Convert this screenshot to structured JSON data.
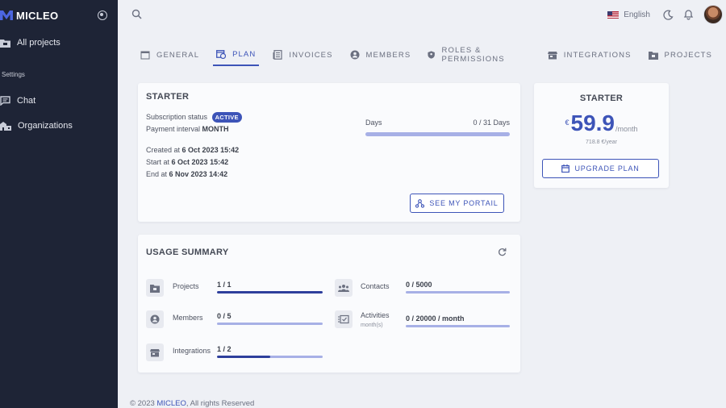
{
  "sidebar": {
    "brand": "MICLEO",
    "all_projects": "All projects",
    "section": "Settings",
    "items": [
      {
        "label": "Chat",
        "icon": "chat-icon"
      },
      {
        "label": "Organizations",
        "icon": "buildings-icon"
      }
    ]
  },
  "topbar": {
    "language": "English",
    "icons": [
      "search-icon",
      "dark-mode-icon",
      "bell-icon"
    ]
  },
  "tabs": [
    {
      "label": "GENERAL",
      "icon": "browser-icon"
    },
    {
      "label": "PLAN",
      "icon": "calendar-clock-icon",
      "active": true
    },
    {
      "label": "INVOICES",
      "icon": "invoice-icon"
    },
    {
      "label": "MEMBERS",
      "icon": "member-icon"
    },
    {
      "label": "ROLES & PERMISSIONS",
      "icon": "shield-icon"
    },
    {
      "label": "INTEGRATIONS",
      "icon": "store-icon"
    },
    {
      "label": "PROJECTS",
      "icon": "folder-icon"
    }
  ],
  "plan": {
    "title": "STARTER",
    "subscription_label": "Subscription status",
    "subscription_status": "ACTIVE",
    "interval_label": "Payment interval",
    "interval_value": "MONTH",
    "days_label": "Days",
    "days_value": "0 / 31 Days",
    "days_progress": 0,
    "created_label": "Created at",
    "created_value": "6 Oct 2023 15:42",
    "start_label": "Start at",
    "start_value": "6 Oct 2023 15:42",
    "end_label": "End at",
    "end_value": "6 Nov 2023 14:42",
    "portal_button": "SEE MY PORTAIL"
  },
  "pricing": {
    "title": "STARTER",
    "currency": "€",
    "price": "59.9",
    "period": "/month",
    "yearly": "718.8 €/year",
    "upgrade_button": "UPGRADE PLAN"
  },
  "usage": {
    "title": "USAGE SUMMARY",
    "items": [
      {
        "label": "Projects",
        "value": "1 / 1",
        "progress": 1.0,
        "icon": "folder-icon"
      },
      {
        "label": "Contacts",
        "value": "0 / 5000",
        "progress": 0.0,
        "icon": "contacts-icon"
      },
      {
        "label": "Members",
        "value": "0 / 5",
        "progress": 0.0,
        "icon": "member-icon"
      },
      {
        "label": "Activities",
        "sub": "month(s)",
        "value": "0 / 20000 / month",
        "progress": 0.0,
        "icon": "activities-icon"
      },
      {
        "label": "Integrations",
        "value": "1 / 2",
        "progress": 0.5,
        "icon": "store-icon"
      }
    ]
  },
  "footer": {
    "prefix": "© 2023 ",
    "brand": "MICLEO",
    "suffix": ", All rights Reserved"
  },
  "colors": {
    "sidebar_bg": "#1e2436",
    "accent": "#3d54b8",
    "page_bg": "#eef0f5"
  }
}
